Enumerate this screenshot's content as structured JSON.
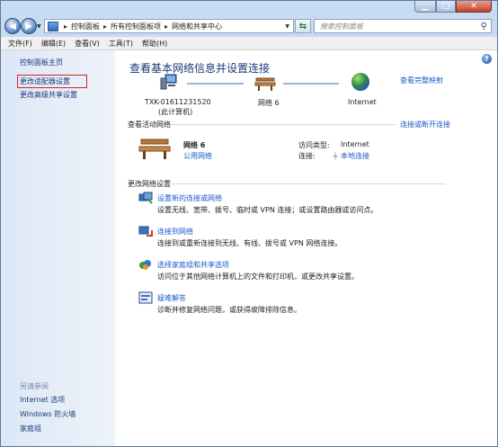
{
  "window": {
    "min_symbol": "▁",
    "max_symbol": "□",
    "close_symbol": "✕"
  },
  "address": {
    "crumbs": [
      "控制面板",
      "所有控制面板项",
      "网络和共享中心"
    ],
    "separator": "▸",
    "search_placeholder": "搜索控制面板"
  },
  "menu": [
    "文件(F)",
    "编辑(E)",
    "查看(V)",
    "工具(T)",
    "帮助(H)"
  ],
  "sidebar": {
    "home": "控制面板主页",
    "links": [
      "更改适配器设置",
      "更改高级共享设置"
    ],
    "see_also_title": "另请参阅",
    "see_also": [
      "Internet 选项",
      "Windows 防火墙",
      "家庭组"
    ]
  },
  "main": {
    "title": "查看基本网络信息并设置连接",
    "full_map_link": "查看完整映射",
    "map": {
      "computer_name": "TXK-01611231520",
      "computer_sub": "(此计算机)",
      "network_name": "网络 6",
      "internet": "Internet"
    },
    "active_section": {
      "title": "查看活动网络",
      "connect_link": "连接或断开连接",
      "network_name": "网络 6",
      "network_type": "公用网络",
      "access_type_label": "访问类型:",
      "access_type_value": "Internet",
      "connection_label": "连接:",
      "connection_value": "本地连接"
    },
    "change_section": {
      "title": "更改网络设置",
      "tasks": [
        {
          "title": "设置新的连接或网络",
          "desc": "设置无线、宽带、拨号、临时或 VPN 连接；或设置路由器或访问点。"
        },
        {
          "title": "连接到网络",
          "desc": "连接到或重新连接到无线、有线、拨号或 VPN 网络连接。"
        },
        {
          "title": "选择家庭组和共享选项",
          "desc": "访问位于其他网络计算机上的文件和打印机，或更改共享设置。"
        },
        {
          "title": "疑难解答",
          "desc": "诊断并修复网络问题，或获得故障排除信息。"
        }
      ]
    }
  }
}
